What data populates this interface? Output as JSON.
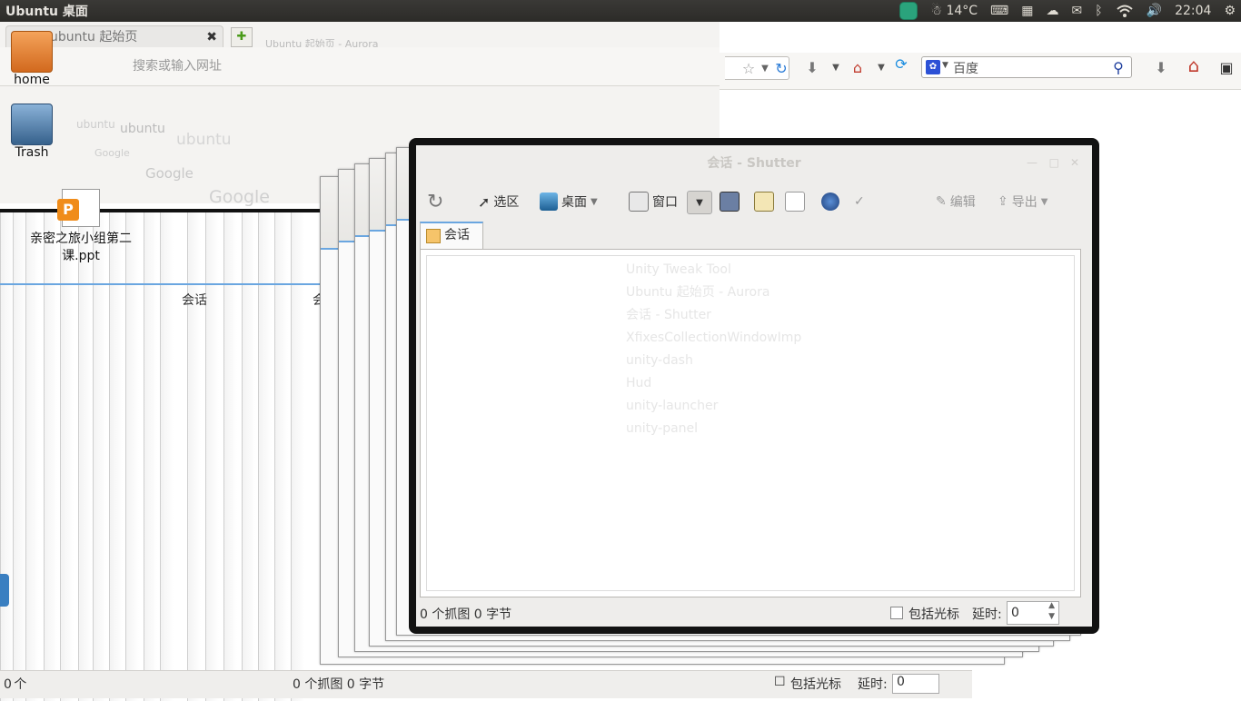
{
  "panel": {
    "title": "Ubuntu 桌面",
    "temperature": "14°C",
    "clock": "22:04"
  },
  "browser": {
    "tab_title": "ubuntu 起始页",
    "tab_close": "✖",
    "new_tab": "✚",
    "url_placeholder": "搜索或输入网址",
    "search_engine_text": "百度",
    "ghost_title": "Ubuntu 起始页 - Aurora",
    "ghost_logo": "ubuntu",
    "ghost_google": "Google"
  },
  "desktop_icons": [
    {
      "label": "home"
    },
    {
      "label": "Trash"
    },
    {
      "label": "亲密之旅小组第二课.ppt"
    }
  ],
  "shutter": {
    "window_title": "会话 - Shutter",
    "toolbar": {
      "selection": "选区",
      "desktop": "桌面",
      "window": "窗口",
      "edit": "编辑",
      "export": "导出"
    },
    "tab_label": "会话",
    "ghost_list": [
      "Unity Tweak Tool",
      "Ubuntu 起始页 - Aurora",
      "会话 - Shutter",
      "XfixesCollectionWindowImp",
      "unity-dash",
      "Hud",
      "unity-launcher",
      "unity-panel"
    ],
    "status": {
      "info": "0 个抓图  0 字节",
      "include_cursor": "包括光标",
      "delay_label": "延时:",
      "delay_value": "0"
    }
  },
  "back_stack": {
    "status_repeat": "0 个",
    "status_text": "0 个抓图  0 字节",
    "include_cursor": "包括光标",
    "delay_label": "延时:",
    "delay_value": "0",
    "tab_label": "会话"
  }
}
